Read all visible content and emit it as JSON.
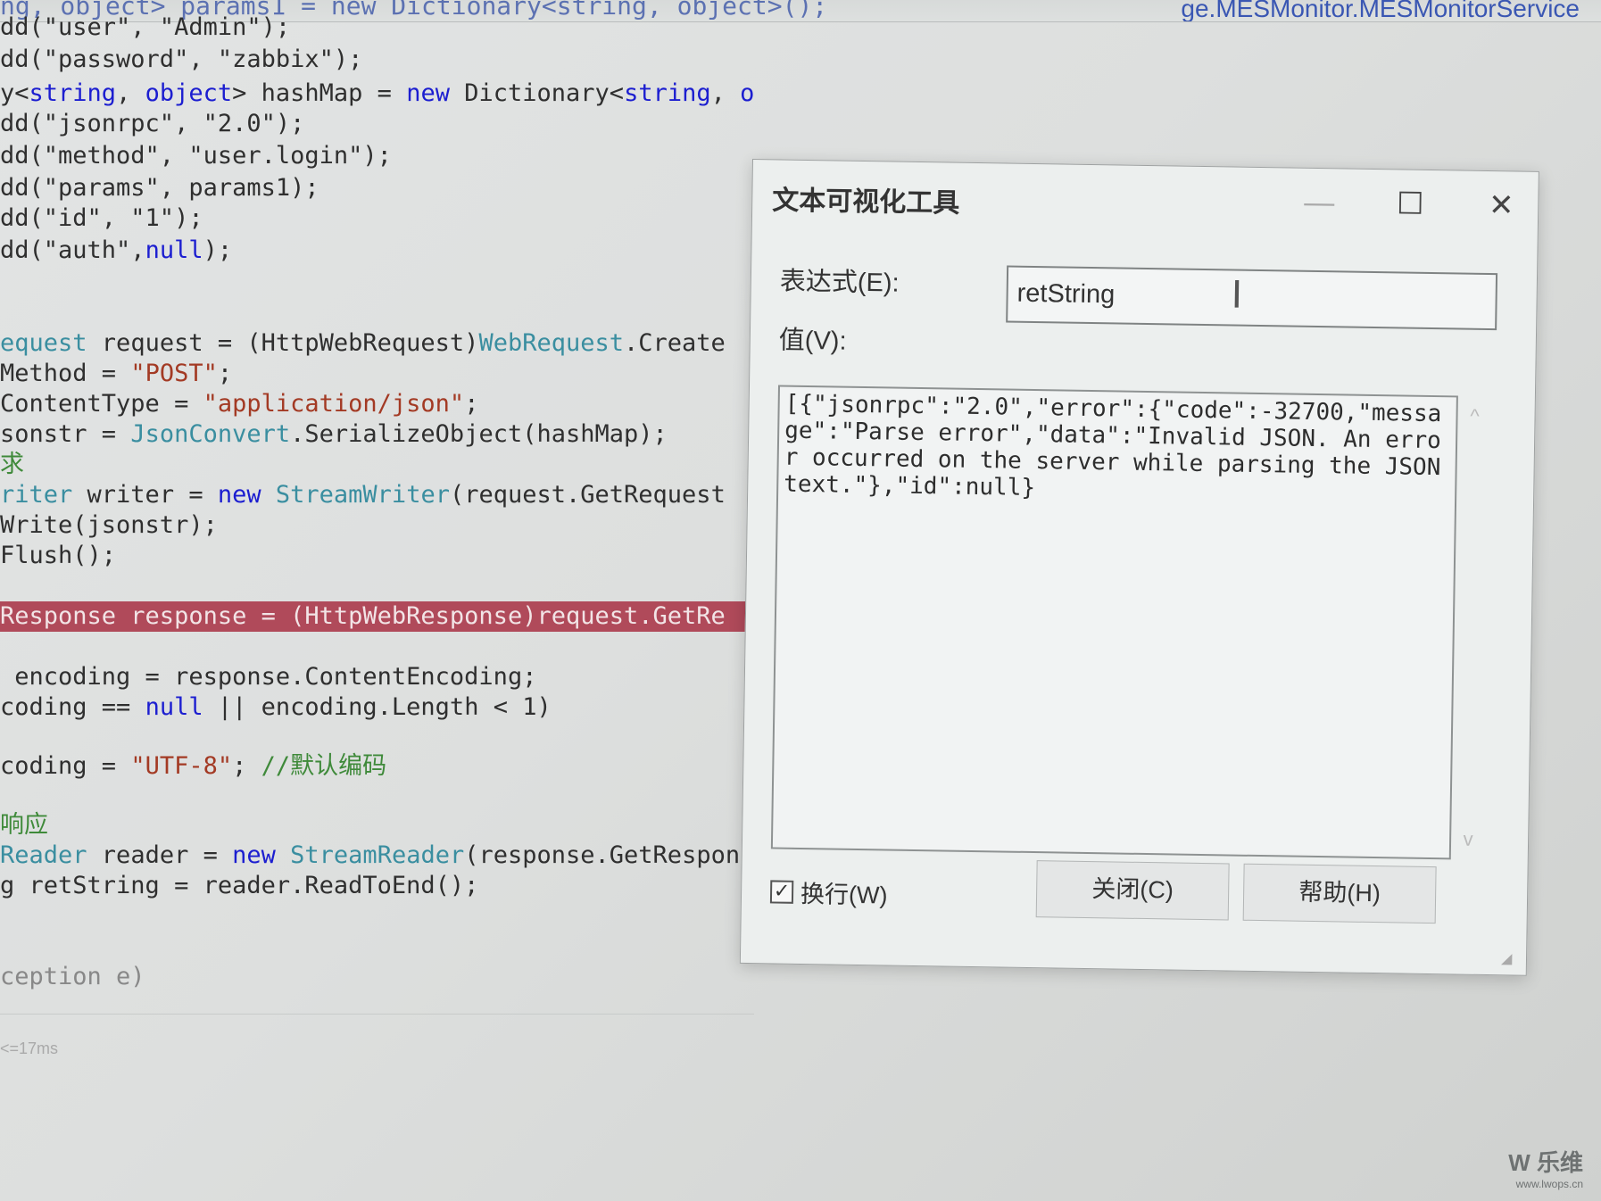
{
  "background": {
    "top_fragment": "ng, object> params1 = new Dictionary<string, object>();",
    "service_name": "ge.MESMonitor.MESMonitorService"
  },
  "code_lines": [
    [
      {
        "t": "dd(\"user\", \"Admin\");",
        "c": ""
      }
    ],
    [
      {
        "t": "dd(\"password\", \"zabbix\");",
        "c": ""
      }
    ],
    [
      {
        "t": "y<",
        "c": ""
      },
      {
        "t": "string",
        "c": "kw"
      },
      {
        "t": ", ",
        "c": ""
      },
      {
        "t": "object",
        "c": "kw"
      },
      {
        "t": "> hashMap = ",
        "c": ""
      },
      {
        "t": "new",
        "c": "kw"
      },
      {
        "t": " Dictionary<",
        "c": ""
      },
      {
        "t": "string",
        "c": "kw"
      },
      {
        "t": ", ",
        "c": ""
      },
      {
        "t": "object",
        "c": "kw"
      },
      {
        "t": ">();",
        "c": ""
      }
    ],
    [
      {
        "t": "dd(\"jsonrpc\", \"2.0\");",
        "c": ""
      }
    ],
    [
      {
        "t": "dd(\"method\", \"user.login\");",
        "c": ""
      }
    ],
    [
      {
        "t": "dd(\"params\", params1);",
        "c": ""
      }
    ],
    [
      {
        "t": "dd(\"id\", \"1\");",
        "c": ""
      }
    ],
    [
      {
        "t": "dd(\"auth\",",
        "c": ""
      },
      {
        "t": "null",
        "c": "kw"
      },
      {
        "t": ");",
        "c": ""
      }
    ],
    [],
    [],
    [
      {
        "t": "equest",
        "c": "ty"
      },
      {
        "t": " request = (HttpWebRequest)",
        "c": ""
      },
      {
        "t": "WebRequest",
        "c": "ty"
      },
      {
        "t": ".Create",
        "c": ""
      }
    ],
    [
      {
        "t": "Method = ",
        "c": ""
      },
      {
        "t": "\"POST\"",
        "c": "str"
      },
      {
        "t": ";",
        "c": ""
      }
    ],
    [
      {
        "t": "ContentType = ",
        "c": ""
      },
      {
        "t": "\"application/json\"",
        "c": "str"
      },
      {
        "t": ";",
        "c": ""
      }
    ],
    [
      {
        "t": "sonstr = ",
        "c": ""
      },
      {
        "t": "JsonConvert",
        "c": "ty"
      },
      {
        "t": ".SerializeObject(hashMap);",
        "c": ""
      }
    ],
    [
      {
        "t": "求",
        "c": "cm"
      }
    ],
    [
      {
        "t": "riter",
        "c": "ty"
      },
      {
        "t": " writer = ",
        "c": ""
      },
      {
        "t": "new",
        "c": "kw"
      },
      {
        "t": " ",
        "c": ""
      },
      {
        "t": "StreamWriter",
        "c": "ty"
      },
      {
        "t": "(request.GetRequest",
        "c": ""
      }
    ],
    [
      {
        "t": "Write(jsonstr);",
        "c": ""
      }
    ],
    [
      {
        "t": "Flush();",
        "c": ""
      }
    ],
    [],
    [
      {
        "t": "Response response = (HttpWebResponse)request.GetRe",
        "c": "hl"
      }
    ],
    [],
    [
      {
        "t": " encoding = response.ContentEncoding;",
        "c": ""
      }
    ],
    [
      {
        "t": "coding == ",
        "c": ""
      },
      {
        "t": "null",
        "c": "kw"
      },
      {
        "t": " || encoding.Length < 1)",
        "c": ""
      }
    ],
    [],
    [
      {
        "t": "coding = ",
        "c": ""
      },
      {
        "t": "\"UTF-8\"",
        "c": "str"
      },
      {
        "t": "; ",
        "c": ""
      },
      {
        "t": "//默认编码",
        "c": "cm"
      }
    ],
    [],
    [
      {
        "t": "响应",
        "c": "cm"
      }
    ],
    [
      {
        "t": "Reader",
        "c": "ty"
      },
      {
        "t": " reader = ",
        "c": ""
      },
      {
        "t": "new",
        "c": "kw"
      },
      {
        "t": " ",
        "c": ""
      },
      {
        "t": "StreamReader",
        "c": "ty"
      },
      {
        "t": "(response.GetRespon",
        "c": ""
      }
    ],
    [
      {
        "t": "g retString = reader.ReadToEnd();",
        "c": ""
      }
    ],
    [],
    [],
    [
      {
        "t": "ception e)",
        "c": "dim"
      }
    ]
  ],
  "perf_tip": "<=17ms",
  "dialog": {
    "title": "文本可视化工具",
    "min_glyph": "—",
    "max_glyph": "☐",
    "close_glyph": "✕",
    "expression_label": "表达式(E):",
    "expression_value": "retString",
    "caret_glyph": "I",
    "value_label": "值(V):",
    "value_text": "[{\"jsonrpc\":\"2.0\",\"error\":{\"code\":-32700,\"message\":\"Parse error\",\"data\":\"Invalid JSON. An error occurred on the server while parsing the JSON text.\"},\"id\":null}",
    "wrap_label": "换行(W)",
    "wrap_checked": true,
    "close_button": "关闭(C)",
    "help_button": "帮助(H)"
  },
  "watermark": {
    "brand": "W 乐维",
    "url": "www.lwops.cn"
  }
}
